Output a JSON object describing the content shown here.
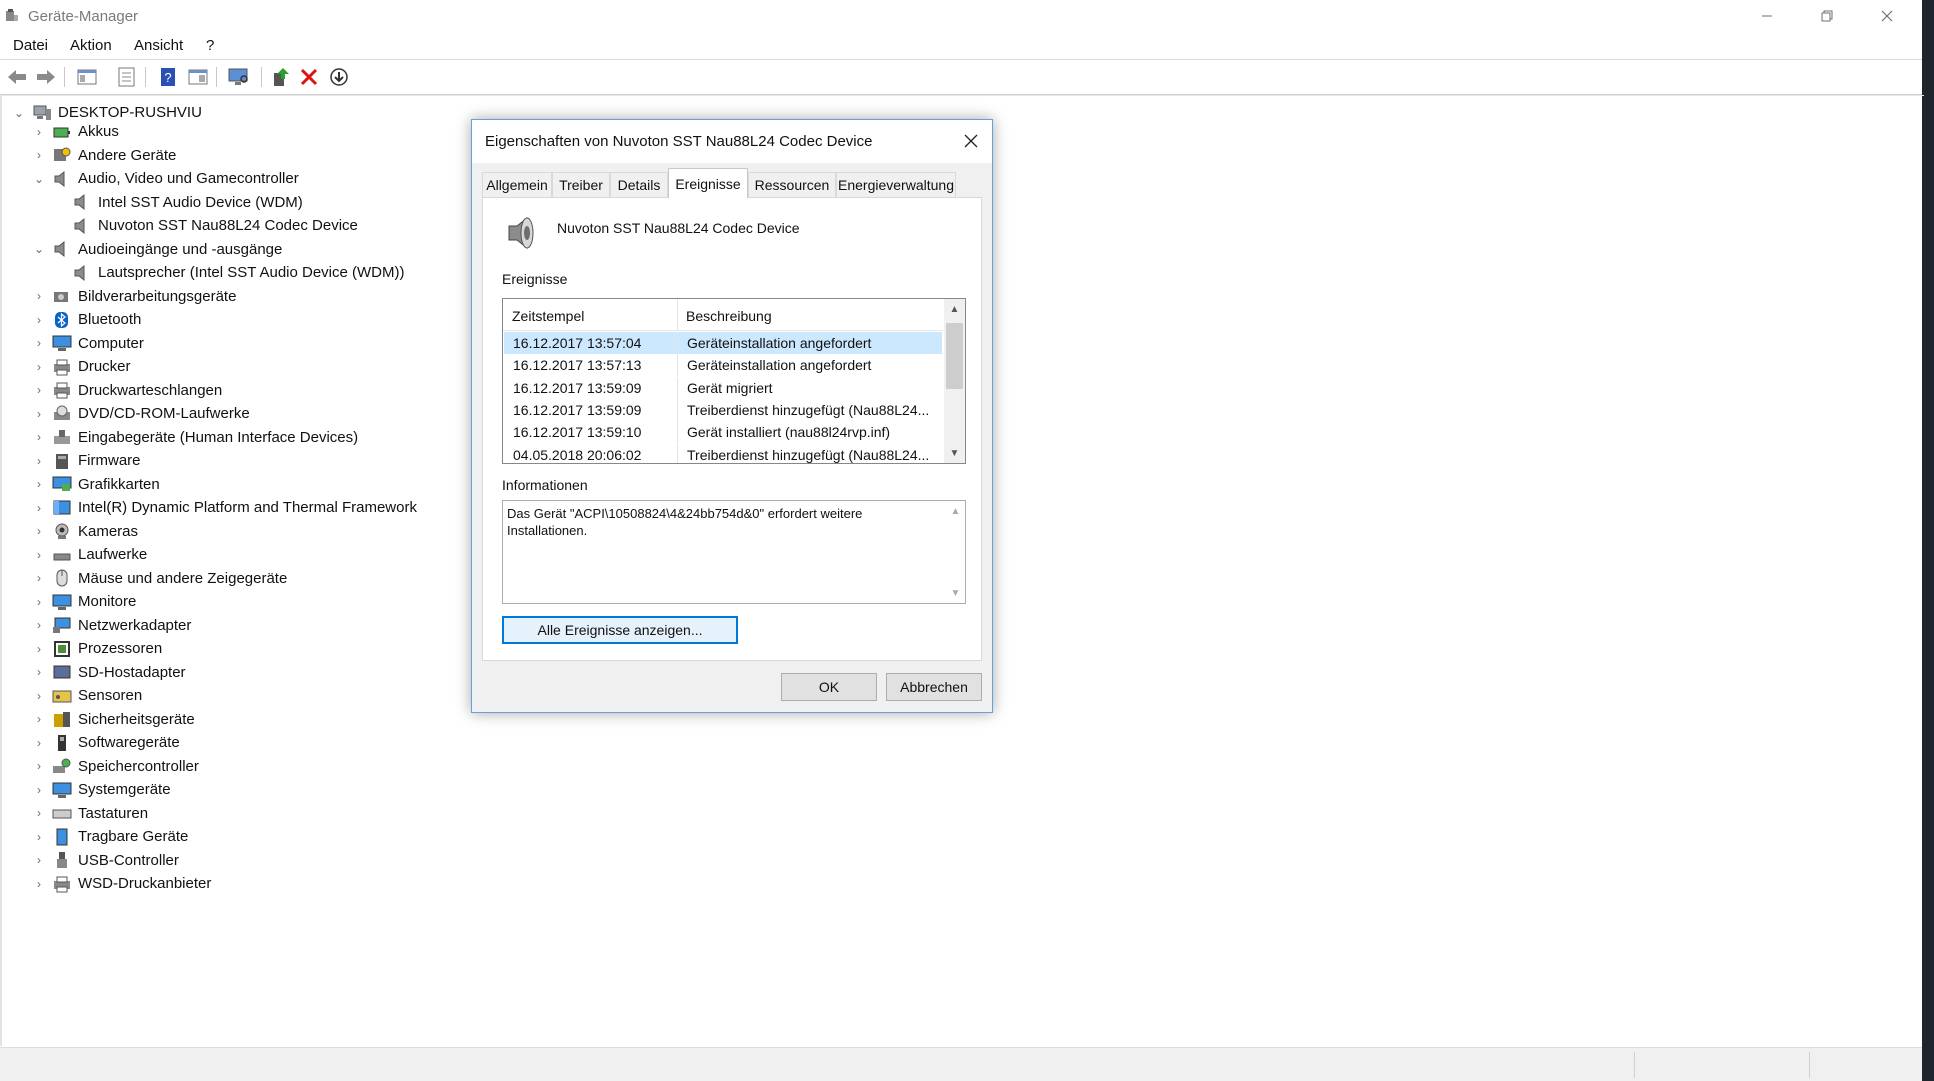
{
  "window": {
    "title": "Geräte-Manager",
    "icon": "device-manager-icon"
  },
  "menu": [
    "Datei",
    "Aktion",
    "Ansicht",
    "?"
  ],
  "toolbar": [
    "back-arrow-icon",
    "forward-arrow-icon",
    "show-tree-icon",
    "properties-icon",
    "help-icon",
    "view-icon",
    "monitor-scan-icon",
    "update-driver-icon",
    "uninstall-icon",
    "download-icon"
  ],
  "tree": {
    "root": "DESKTOP-RUSHVIU",
    "items": [
      {
        "label": "Akkus",
        "icon": "battery-icon",
        "level": 1,
        "expanded": false
      },
      {
        "label": "Andere Geräte",
        "icon": "unknown-device-icon",
        "level": 1,
        "expanded": false
      },
      {
        "label": "Audio, Video und Gamecontroller",
        "icon": "speaker-icon",
        "level": 1,
        "expanded": true
      },
      {
        "label": "Intel SST Audio Device (WDM)",
        "icon": "speaker-icon",
        "level": 2
      },
      {
        "label": "Nuvoton SST Nau88L24 Codec Device",
        "icon": "speaker-icon",
        "level": 2
      },
      {
        "label": "Audioeingänge und -ausgänge",
        "icon": "speaker-icon",
        "level": 1,
        "expanded": true
      },
      {
        "label": "Lautsprecher (Intel SST Audio Device (WDM))",
        "icon": "speaker-icon",
        "level": 2
      },
      {
        "label": "Bildverarbeitungsgeräte",
        "icon": "camera-icon",
        "level": 1,
        "expanded": false
      },
      {
        "label": "Bluetooth",
        "icon": "bluetooth-icon",
        "level": 1,
        "expanded": false
      },
      {
        "label": "Computer",
        "icon": "computer-icon",
        "level": 1,
        "expanded": false
      },
      {
        "label": "Drucker",
        "icon": "printer-icon",
        "level": 1,
        "expanded": false
      },
      {
        "label": "Druckwarteschlangen",
        "icon": "printer-icon",
        "level": 1,
        "expanded": false
      },
      {
        "label": "DVD/CD-ROM-Laufwerke",
        "icon": "disc-icon",
        "level": 1,
        "expanded": false
      },
      {
        "label": "Eingabegeräte (Human Interface Devices)",
        "icon": "hid-icon",
        "level": 1,
        "expanded": false
      },
      {
        "label": "Firmware",
        "icon": "firmware-icon",
        "level": 1,
        "expanded": false
      },
      {
        "label": "Grafikkarten",
        "icon": "display-adapter-icon",
        "level": 1,
        "expanded": false
      },
      {
        "label": "Intel(R) Dynamic Platform and Thermal Framework",
        "icon": "chip-icon",
        "level": 1,
        "expanded": false
      },
      {
        "label": "Kameras",
        "icon": "webcam-icon",
        "level": 1,
        "expanded": false
      },
      {
        "label": "Laufwerke",
        "icon": "drive-icon",
        "level": 1,
        "expanded": false
      },
      {
        "label": "Mäuse und andere Zeigegeräte",
        "icon": "mouse-icon",
        "level": 1,
        "expanded": false
      },
      {
        "label": "Monitore",
        "icon": "monitor-icon",
        "level": 1,
        "expanded": false
      },
      {
        "label": "Netzwerkadapter",
        "icon": "network-icon",
        "level": 1,
        "expanded": false
      },
      {
        "label": "Prozessoren",
        "icon": "processor-icon",
        "level": 1,
        "expanded": false
      },
      {
        "label": "SD-Hostadapter",
        "icon": "sd-card-icon",
        "level": 1,
        "expanded": false
      },
      {
        "label": "Sensoren",
        "icon": "sensor-icon",
        "level": 1,
        "expanded": false
      },
      {
        "label": "Sicherheitsgeräte",
        "icon": "security-icon",
        "level": 1,
        "expanded": false
      },
      {
        "label": "Softwaregeräte",
        "icon": "software-device-icon",
        "level": 1,
        "expanded": false
      },
      {
        "label": "Speichercontroller",
        "icon": "storage-controller-icon",
        "level": 1,
        "expanded": false
      },
      {
        "label": "Systemgeräte",
        "icon": "system-device-icon",
        "level": 1,
        "expanded": false
      },
      {
        "label": "Tastaturen",
        "icon": "keyboard-icon",
        "level": 1,
        "expanded": false
      },
      {
        "label": "Tragbare Geräte",
        "icon": "portable-device-icon",
        "level": 1,
        "expanded": false
      },
      {
        "label": "USB-Controller",
        "icon": "usb-icon",
        "level": 1,
        "expanded": false
      },
      {
        "label": "WSD-Druckanbieter",
        "icon": "printer-icon",
        "level": 1,
        "expanded": false
      }
    ]
  },
  "dialog": {
    "title": "Eigenschaften von Nuvoton SST Nau88L24 Codec Device",
    "tabs": [
      "Allgemein",
      "Treiber",
      "Details",
      "Ereignisse",
      "Ressourcen",
      "Energieverwaltung"
    ],
    "active_tab": "Ereignisse",
    "device_name": "Nuvoton SST Nau88L24 Codec Device",
    "events_label": "Ereignisse",
    "columns": [
      "Zeitstempel",
      "Beschreibung"
    ],
    "events": [
      {
        "time": "16.12.2017 13:57:04",
        "desc": "Geräteinstallation angefordert",
        "selected": true
      },
      {
        "time": "16.12.2017 13:57:13",
        "desc": "Geräteinstallation angefordert",
        "selected": false
      },
      {
        "time": "16.12.2017 13:59:09",
        "desc": "Gerät migriert",
        "selected": false
      },
      {
        "time": "16.12.2017 13:59:09",
        "desc": "Treiberdienst hinzugefügt (Nau88L24...",
        "selected": false
      },
      {
        "time": "16.12.2017 13:59:10",
        "desc": "Gerät installiert (nau88l24rvp.inf)",
        "selected": false
      },
      {
        "time": "04.05.2018 20:06:02",
        "desc": "Treiberdienst hinzugefügt (Nau88L24...",
        "selected": false
      }
    ],
    "info_label": "Informationen",
    "info_text": "Das Gerät \"ACPI\\10508824\\4&24bb754d&0\" erfordert weitere Installationen.",
    "all_events_button": "Alle Ereignisse anzeigen...",
    "ok_button": "OK",
    "cancel_button": "Abbrechen"
  }
}
